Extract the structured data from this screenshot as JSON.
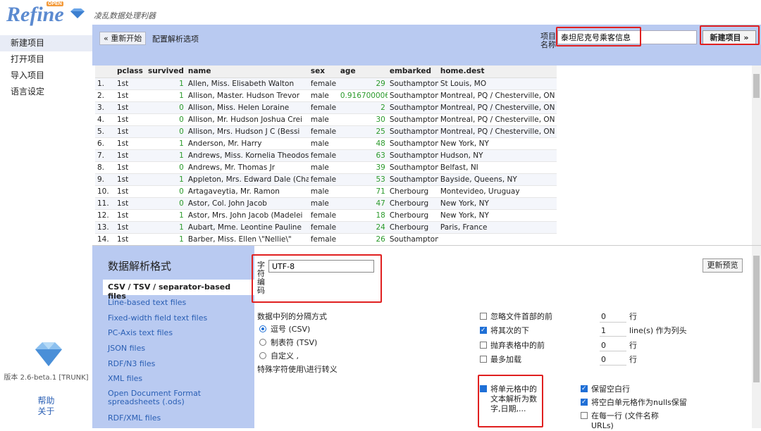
{
  "app": {
    "logo_text": "Refine",
    "logo_badge": "OPEN",
    "subtitle": "凌乱数据处理利器"
  },
  "nav": {
    "items": [
      "新建项目",
      "打开项目",
      "导入项目",
      "语言设定"
    ],
    "version": "版本 2.6-beta.1 [TRUNK]",
    "help": "帮助",
    "about": "关于"
  },
  "toolbar": {
    "restart": "« 重新开始",
    "config_label": "配置解析选项",
    "project_name_label": "项目名称",
    "project_name_value": "泰坦尼克号乘客信息",
    "create_button": "新建项目 »"
  },
  "grid": {
    "columns": [
      "",
      "pclass",
      "survived",
      "name",
      "sex",
      "age",
      "embarked",
      "home.dest"
    ],
    "rows": [
      [
        "1.",
        "1st",
        "1",
        "Allen, Miss. Elisabeth Walton",
        "female",
        "29",
        "Southampton",
        "St Louis, MO"
      ],
      [
        "2.",
        "1st",
        "1",
        "Allison, Master. Hudson Trevor",
        "male",
        "0.916700006",
        "Southampton",
        "Montreal, PQ / Chesterville, ON"
      ],
      [
        "3.",
        "1st",
        "0",
        "Allison, Miss. Helen Loraine",
        "female",
        "2",
        "Southampton",
        "Montreal, PQ / Chesterville, ON"
      ],
      [
        "4.",
        "1st",
        "0",
        "Allison, Mr. Hudson Joshua Crei",
        "male",
        "30",
        "Southampton",
        "Montreal, PQ / Chesterville, ON"
      ],
      [
        "5.",
        "1st",
        "0",
        "Allison, Mrs. Hudson J C (Bessi",
        "female",
        "25",
        "Southampton",
        "Montreal, PQ / Chesterville, ON"
      ],
      [
        "6.",
        "1st",
        "1",
        "Anderson, Mr. Harry",
        "male",
        "48",
        "Southampton",
        "New York, NY"
      ],
      [
        "7.",
        "1st",
        "1",
        "Andrews, Miss. Kornelia Theodos",
        "female",
        "63",
        "Southampton",
        "Hudson, NY"
      ],
      [
        "8.",
        "1st",
        "0",
        "Andrews, Mr. Thomas Jr",
        "male",
        "39",
        "Southampton",
        "Belfast, NI"
      ],
      [
        "9.",
        "1st",
        "1",
        "Appleton, Mrs. Edward Dale (Cha",
        "female",
        "53",
        "Southampton",
        "Bayside, Queens, NY"
      ],
      [
        "10.",
        "1st",
        "0",
        "Artagaveytia, Mr. Ramon",
        "male",
        "71",
        "Cherbourg",
        "Montevideo, Uruguay"
      ],
      [
        "11.",
        "1st",
        "0",
        "Astor, Col. John Jacob",
        "male",
        "47",
        "Cherbourg",
        "New York, NY"
      ],
      [
        "12.",
        "1st",
        "1",
        "Astor, Mrs. John Jacob (Madelei",
        "female",
        "18",
        "Cherbourg",
        "New York, NY"
      ],
      [
        "13.",
        "1st",
        "1",
        "Aubart, Mme. Leontine Pauline",
        "female",
        "24",
        "Cherbourg",
        "Paris, France"
      ],
      [
        "14.",
        "1st",
        "1",
        "Barber, Miss. Ellen \\\"Nellie\\\"",
        "female",
        "26",
        "Southampton",
        ""
      ]
    ]
  },
  "parse": {
    "title": "数据解析格式",
    "formats": [
      "CSV / TSV / separator-based files",
      "Line-based text files",
      "Fixed-width field text files",
      "PC-Axis text files",
      "JSON files",
      "RDF/N3 files",
      "XML files",
      "Open Document Format spreadsheets (.ods)",
      "RDF/XML files"
    ],
    "encoding_label": "字符编码",
    "encoding_value": "UTF-8",
    "update_button": "更新预览",
    "sep_title": "数据中列的分隔方式",
    "sep_csv": "逗号 (CSV)",
    "sep_tsv": "制表符 (TSV)",
    "sep_custom": "自定义",
    "sep_custom_value": ",",
    "escape": "特殊字符使用\\进行转义",
    "ignore_first": "忽略文件首部的前",
    "ignore_value": "0",
    "ignore_unit": "行",
    "parse_next": "将其次的下",
    "parse_next_value": "1",
    "parse_next_unit": "line(s) 作为列头",
    "discard": "抛弃表格中的前",
    "discard_value": "0",
    "discard_unit": "行",
    "max_load": "最多加载",
    "max_value": "0",
    "max_unit": "行",
    "parse_cells": "将单元格中的文本解析为数字,日期,...",
    "keep_blank": "保留空白行",
    "blank_as_null": "将空白单元格作为nulls保留",
    "per_row": "在每一行 (文件名称 URLs)"
  }
}
